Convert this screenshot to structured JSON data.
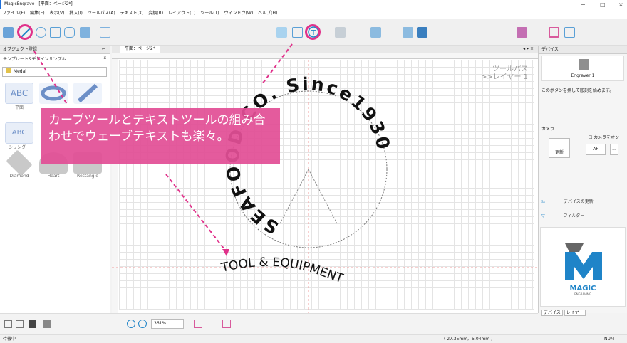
{
  "app": {
    "title": "MagicEngrave - [平面：ページ2*]",
    "win_min": "−",
    "win_max": "□",
    "win_close": "×"
  },
  "menu": [
    "ファイル(F)",
    "編集(E)",
    "表示(V)",
    "挿入(I)",
    "ツールパス(A)",
    "テキスト(X)",
    "変換(R)",
    "レイアウト(L)",
    "ツール(T)",
    "ウィンドウ(W)",
    "ヘルプ(H)"
  ],
  "left_panel": {
    "title": "オブジェクト登録",
    "pin": "ꟷ",
    "template_label": "テンプレート&デザインサンプル",
    "close": "x",
    "dropdown": "Medal",
    "items": [
      "平面",
      "",
      "",
      "シリンダー",
      "",
      "",
      "Diamond",
      "Heart",
      "Rectangle"
    ]
  },
  "canvas": {
    "tab": "平面：ページ2*",
    "tab_nav": "◂ ▸ ×",
    "toolpath_label": "ツールパス",
    "layer_label": ">>レイヤー 1",
    "arc_text": "SEAFOOD CO. Since1930",
    "bottom_text": "TOOL & EQUIPMENT"
  },
  "right_panel": {
    "title": "デバイス",
    "device_name": "Engraver 1",
    "hint": "このボタンを押して彫刻を始めます。",
    "camera_label": "カメラ",
    "camera_on": "カメラをオン",
    "update": "更新",
    "af": "AF",
    "more": "...",
    "refresh_device": "デバイスの更新",
    "filter": "フィルター",
    "logo_text": "MAGIC",
    "logo_sub": "ENGRAVING",
    "bottom_tabs": [
      "デバイス",
      "レイヤー"
    ]
  },
  "callout": {
    "text": "カーブツールとテキストツールの組み合わせでウェーブテキストも楽々。"
  },
  "bottom": {
    "zoom": "361%"
  },
  "status": {
    "left": "待機中",
    "coords": "( 27.35mm, -5.04mm )",
    "right": "NUM"
  },
  "colors": {
    "accent": "#e0318a",
    "callout": "#e24f96",
    "brand": "#1f84c8"
  }
}
